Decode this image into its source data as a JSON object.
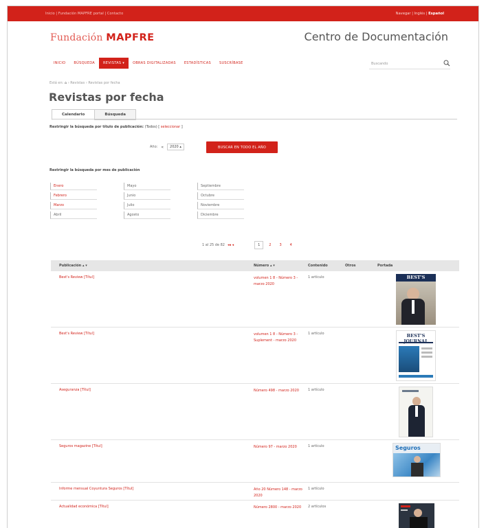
{
  "topbar": {
    "left_text": "Inicio | Fundación MAPFRE portal | Contacto",
    "lang_text": "Navegar | Inglés |",
    "lang_active": "Español"
  },
  "header": {
    "logo_prefix": "Fundación",
    "logo_brand": "MAPFRE",
    "site_title": "Centro de Documentación"
  },
  "nav": {
    "items": [
      "INICIO",
      "BÚSQUEDA",
      "REVISTAS ▾",
      "OBRAS DIGITALIZADAS",
      "ESTADÍSTICAS",
      "SUSCRÍBASE"
    ],
    "active_index": 2
  },
  "search": {
    "placeholder": "Buscando"
  },
  "breadcrumb": {
    "prefix": "Está en:",
    "home": "⌂",
    "trail": "› Revistas › Revistas por fecha"
  },
  "page_title": "Revistas por fecha",
  "tabs": [
    {
      "label": "Calendario",
      "active": true
    },
    {
      "label": "Búsqueda",
      "active": false
    }
  ],
  "restrict_title": {
    "label": "Restringir la búsqueda por título de publicación:",
    "value": " (Todos) [",
    "link": " seleccionar ",
    "end": "]"
  },
  "year_filter": {
    "label": "Año:",
    "prev_arrow": "«",
    "selected": "2020 ▴",
    "button": "BUSCAR EN TODO EL AÑO"
  },
  "restrict_month": {
    "label": "Restringir la búsqueda por mes de publicación"
  },
  "months": [
    {
      "label": "Enero",
      "link": true
    },
    {
      "label": "Mayo",
      "link": false
    },
    {
      "label": "Septiembre",
      "link": false
    },
    {
      "label": "Febrero",
      "link": true
    },
    {
      "label": "Junio",
      "link": false
    },
    {
      "label": "Octubre",
      "link": false
    },
    {
      "label": "Marzo",
      "link": true
    },
    {
      "label": "Julio",
      "link": false
    },
    {
      "label": "Noviembre",
      "link": false
    },
    {
      "label": "Abril",
      "link": false
    },
    {
      "label": "Agosto",
      "link": false
    },
    {
      "label": "Diciembre",
      "link": false
    }
  ],
  "pagination": {
    "range": "1 al 25 de 82",
    "arrows": "◂◂ ◂",
    "pages": [
      "1",
      "2",
      "3",
      "4"
    ],
    "current": "1"
  },
  "table": {
    "headers": {
      "publication": "Publicación ▴ ▾",
      "number": "Número ▴ ▾",
      "contents": "Contenido",
      "others": "Otros",
      "cover": "Portada"
    },
    "rows": [
      {
        "publication": "Best's Review   [Títul]",
        "number": "volumen 1 8 - Número 3 - marzo 2020",
        "contents": "1 artículo",
        "cover": "bests-review"
      },
      {
        "publication": "Best's Review   [Títul]",
        "number": "volumen 1 8 - Número 3 - Suplement - marzo 2020",
        "contents": "1 artículo",
        "cover": "bests-journal"
      },
      {
        "publication": "Aseguranza   [Títul]",
        "number": "Número 498 - marzo 2020",
        "contents": "1 artículo",
        "cover": "aseguranza"
      },
      {
        "publication": "Seguros magazine   [Títul]",
        "number": "Número 97 - marzo 2020",
        "contents": "1 artículo",
        "cover": "seguros"
      },
      {
        "publication": "Informe mensual Coyuntura Seguros   [Títul]",
        "number": "Año 20 Número 148 - marzo 2020",
        "contents": "1 artículo",
        "cover": ""
      },
      {
        "publication": "Actualidad económica   [Títul]",
        "number": "Número 2800 - marzo 2020",
        "contents": "2 artículos",
        "cover": "actualidad"
      }
    ]
  },
  "cover_titles": {
    "bests_review": "BEST'S REVIEW",
    "bests_journal": "BEST'S JOURNAL",
    "seguros": "Seguros"
  },
  "colors": {
    "brand": "#d2221a",
    "link": "#d2221a",
    "header_bg": "#e6e6e6"
  }
}
